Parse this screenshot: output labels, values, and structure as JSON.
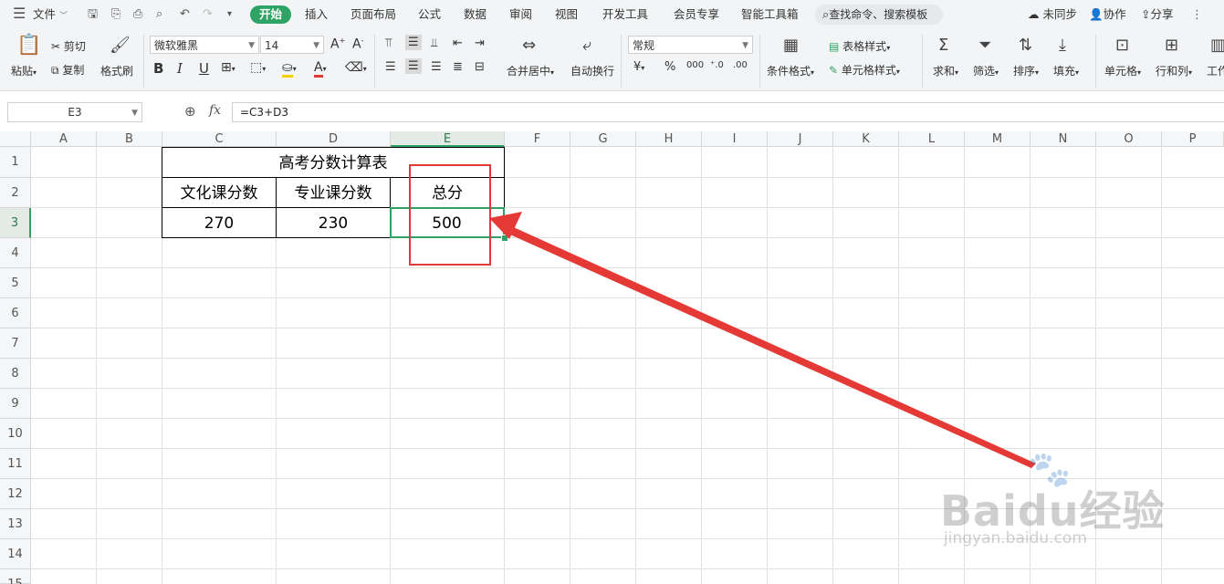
{
  "menubar": {
    "file_label": "文件",
    "tabs": [
      "开始",
      "插入",
      "页面布局",
      "公式",
      "数据",
      "审阅",
      "视图",
      "开发工具",
      "会员专享",
      "智能工具箱"
    ],
    "search": "查找命令、搜索模板",
    "sync": "未同步",
    "collab": "协作",
    "share": "分享"
  },
  "ribbon": {
    "paste": "粘贴",
    "cut": "剪切",
    "copy": "复制",
    "format_painter": "格式刷",
    "font_name": "微软雅黑",
    "font_size": "14",
    "merge_center": "合并居中",
    "wrap_text": "自动换行",
    "number_format": "常规",
    "conditional_format": "条件格式",
    "table_style": "表格样式",
    "cell_style": "单元格样式",
    "sum": "求和",
    "filter": "筛选",
    "sort": "排序",
    "fill": "填充",
    "cell": "单元格",
    "row_col": "行和列",
    "worksheet": "工作"
  },
  "formula_bar": {
    "cell_ref": "E3",
    "fx": "fx",
    "formula": "=C3+D3"
  },
  "sheet": {
    "columns": [
      "A",
      "B",
      "C",
      "D",
      "E",
      "F",
      "G",
      "H",
      "I",
      "J",
      "K",
      "L",
      "M",
      "N",
      "O",
      "P"
    ],
    "rows": [
      "1",
      "2",
      "3",
      "4",
      "5",
      "6",
      "7",
      "8",
      "9",
      "10",
      "11",
      "12",
      "13",
      "14",
      "15"
    ],
    "title": "高考分数计算表",
    "header_c": "文化课分数",
    "header_d": "专业课分数",
    "header_e": "总分",
    "value_c": "270",
    "value_d": "230",
    "value_e": "500",
    "active_cell": "E3"
  },
  "watermark": {
    "brand": "Baidu经验",
    "url": "jingyan.baidu.com"
  },
  "colors": {
    "accent": "#2fa364",
    "annotation": "#e53935"
  }
}
